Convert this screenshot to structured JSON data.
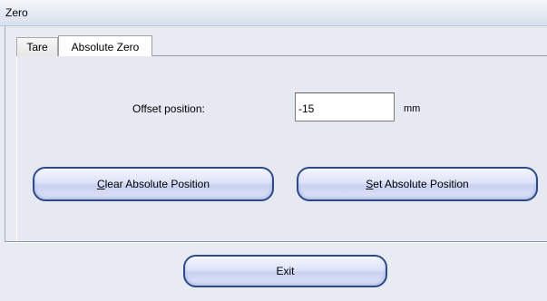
{
  "window": {
    "title": "Zero"
  },
  "tabs": [
    {
      "label": "Tare",
      "active": false
    },
    {
      "label": "Absolute Zero",
      "active": true
    }
  ],
  "offset": {
    "label": "Offset position:",
    "value": "-15",
    "unit": "mm"
  },
  "buttons": {
    "clear": {
      "mnemonic": "C",
      "rest": "lear Absolute Position"
    },
    "set": {
      "mnemonic": "S",
      "rest": "et Absolute Position"
    },
    "exit": {
      "label": "Exit"
    }
  },
  "colors": {
    "button_border": "#2c4a8a",
    "button_fill": "#dde3f8",
    "background": "#e8ebf2"
  }
}
